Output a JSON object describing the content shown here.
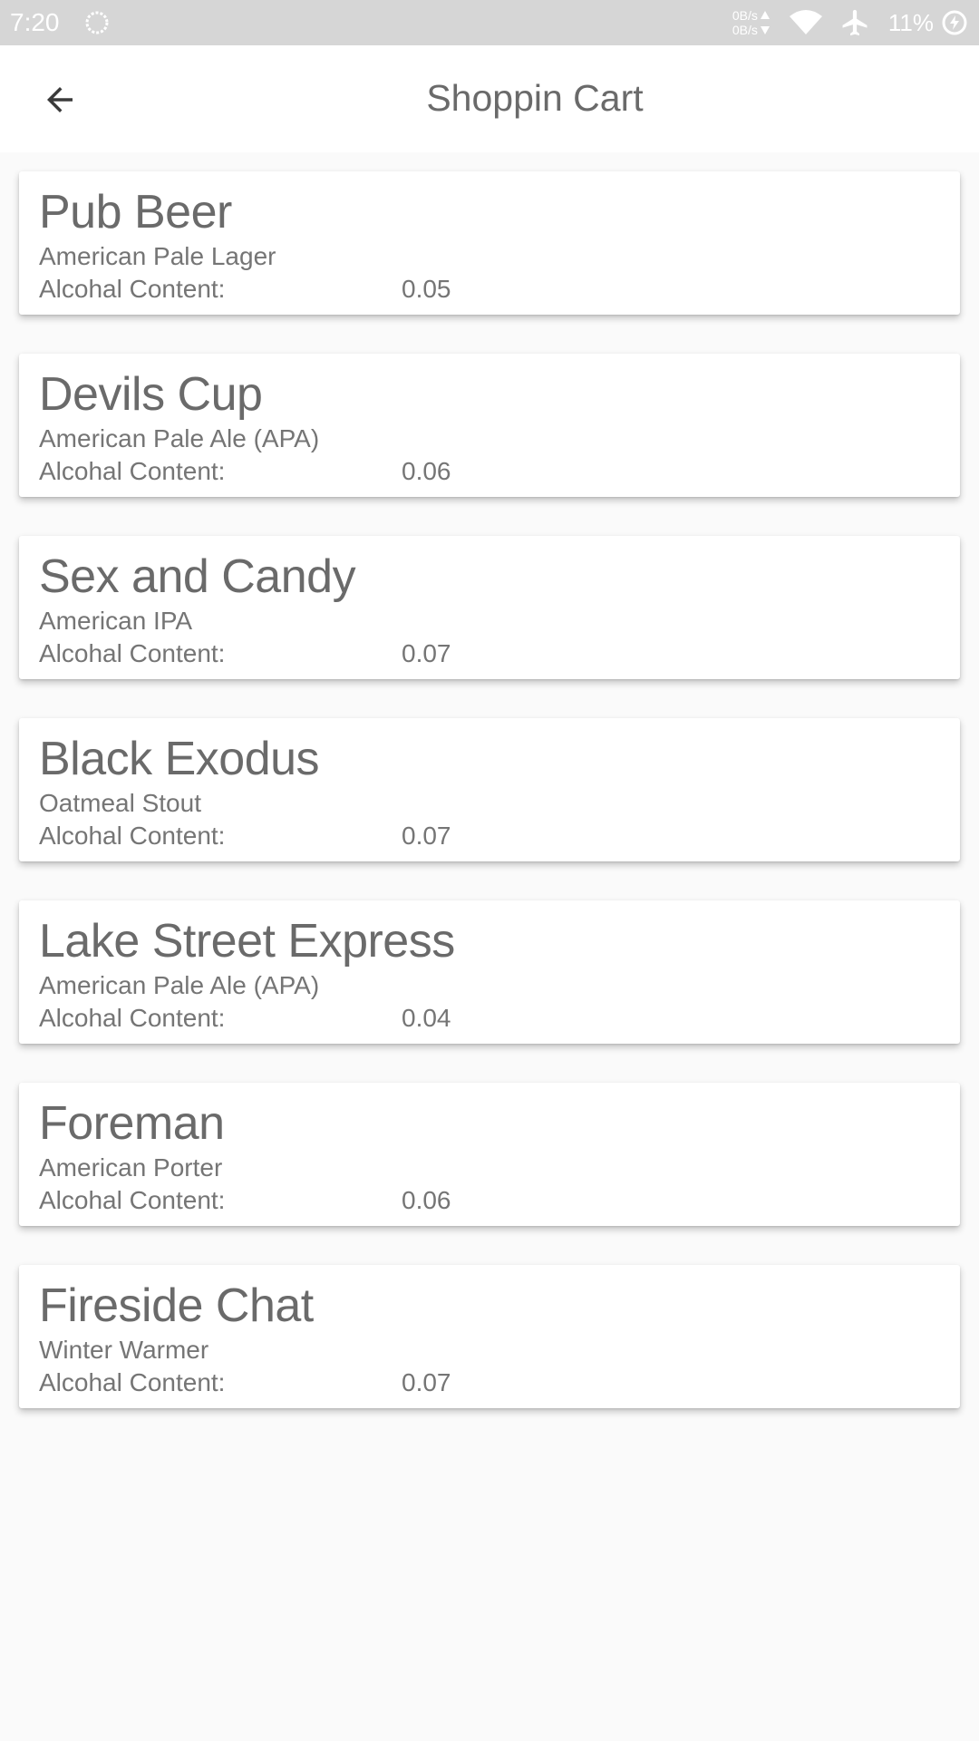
{
  "status_bar": {
    "time": "7:20",
    "net_up": "0B/s",
    "net_down": "0B/s",
    "battery": "11%"
  },
  "app_bar": {
    "title": "Shoppin Cart"
  },
  "cart": {
    "alc_label": "Alcohal Content:",
    "items": [
      {
        "name": "Pub Beer",
        "style": "American Pale Lager",
        "alcohol": "0.05"
      },
      {
        "name": "Devils Cup",
        "style": "American Pale Ale (APA)",
        "alcohol": "0.06"
      },
      {
        "name": "Sex and Candy",
        "style": "American IPA",
        "alcohol": "0.07"
      },
      {
        "name": "Black Exodus",
        "style": "Oatmeal Stout",
        "alcohol": "0.07"
      },
      {
        "name": "Lake Street Express",
        "style": "American Pale Ale (APA)",
        "alcohol": "0.04"
      },
      {
        "name": "Foreman",
        "style": "American Porter",
        "alcohol": "0.06"
      },
      {
        "name": "Fireside Chat",
        "style": "Winter Warmer",
        "alcohol": "0.07"
      }
    ]
  },
  "icons": {
    "back": "arrow-back-icon",
    "wifi": "wifi-icon",
    "airplane": "airplane-mode-icon",
    "battery": "battery-charging-icon",
    "sync": "sync-circle-icon"
  },
  "colors": {
    "status_bar_bg": "#d6d6d6",
    "app_bar_bg": "#ffffff",
    "page_bg": "#fafafa",
    "text_primary": "#6a6a6a",
    "text_secondary": "#757575"
  }
}
